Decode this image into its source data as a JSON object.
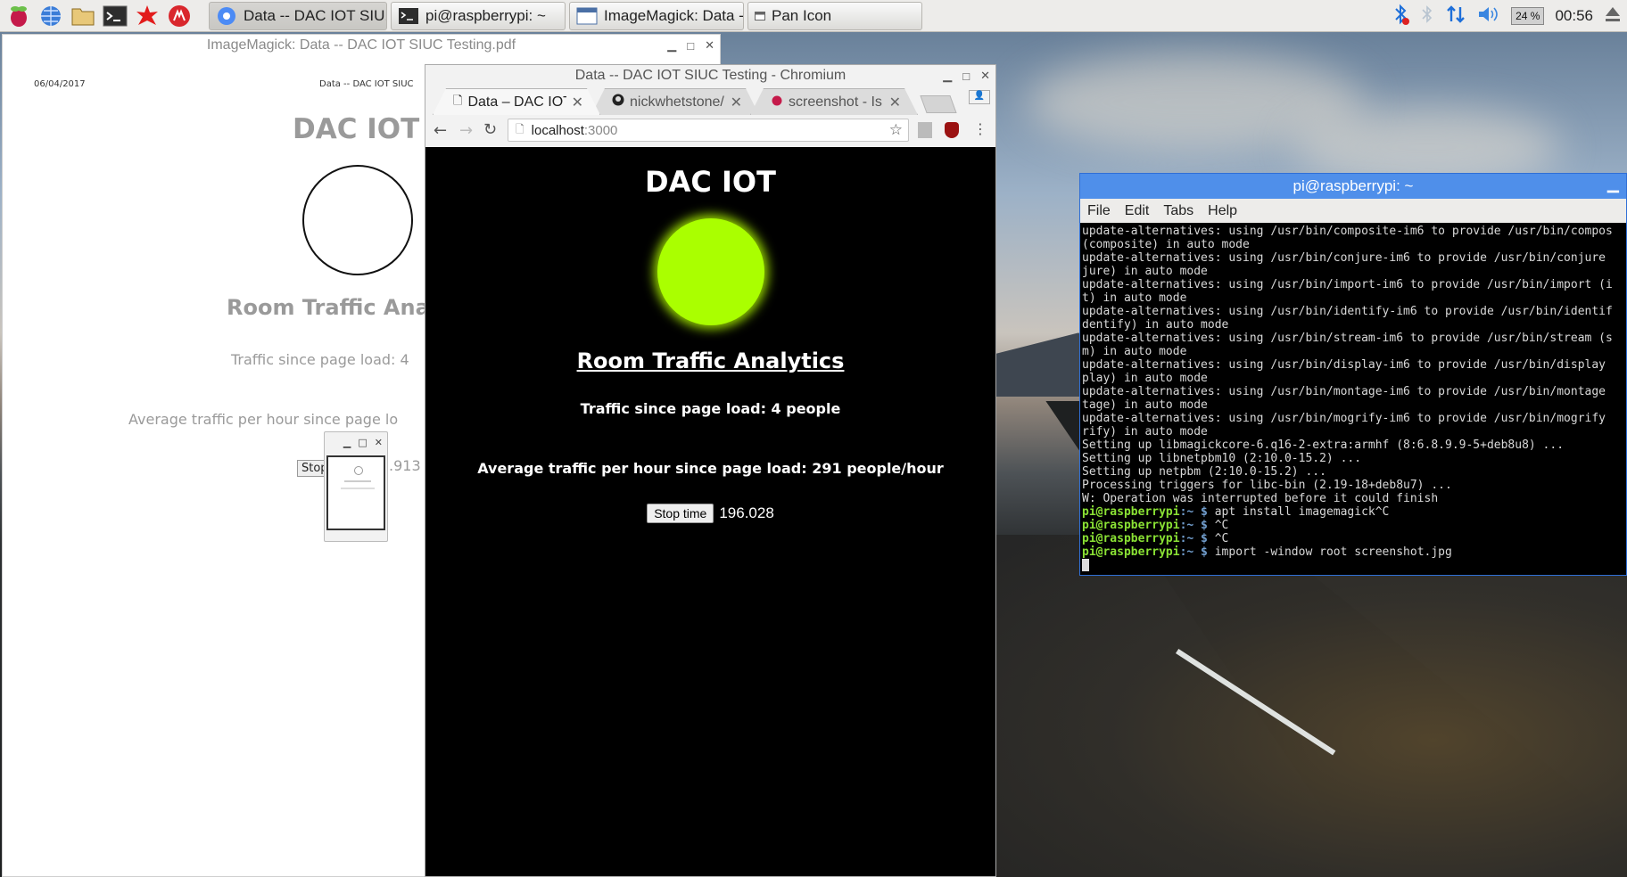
{
  "taskbar": {
    "launchers": [
      "raspberry-menu-icon",
      "web-browser-icon",
      "file-manager-icon",
      "terminal-icon",
      "math-icon",
      "wolfram-icon"
    ],
    "tasks": [
      {
        "label": "Data -- DAC IOT SIU...",
        "icon": "chromium-icon",
        "active": true
      },
      {
        "label": "pi@raspberrypi: ~",
        "icon": "terminal-icon",
        "active": false
      },
      {
        "label": "ImageMagick: Data -...",
        "icon": "window-icon",
        "active": false
      },
      {
        "label": "Pan Icon",
        "icon": "small-window-icon",
        "active": false
      }
    ],
    "tray": {
      "cpu": "24 %",
      "clock": "00:56"
    }
  },
  "imagemagick": {
    "title": "ImageMagick: Data -- DAC IOT SIUC Testing.pdf",
    "date": "06/04/2017",
    "header_right": "Data -- DAC IOT SIUC",
    "heading": "DAC IOT",
    "section": "Room Traffic Ana",
    "traffic_line": "Traffic since page load: 4",
    "avg_line": "Average traffic per hour since page lo",
    "stop_btn": "Stop",
    "timer": ".913"
  },
  "chromium": {
    "title": "Data -- DAC IOT SIUC Testing - Chromium",
    "tabs": [
      {
        "label": "Data – DAC IOT S",
        "icon": "page-icon"
      },
      {
        "label": "nickwhetstone/D",
        "icon": "github-icon"
      },
      {
        "label": "screenshot - Is th",
        "icon": "raspberry-icon"
      }
    ],
    "url_host": "localhost",
    "url_port": ":3000",
    "page": {
      "heading": "DAC IOT",
      "indicator_color": "#aaff00",
      "section": "Room Traffic Analytics",
      "traffic_line": "Traffic since page load: 4 people",
      "avg_line": "Average traffic per hour since page load: 291 people/hour",
      "stop_btn": "Stop time",
      "timer": "196.028"
    }
  },
  "terminal": {
    "title": "pi@raspberrypi: ~",
    "menu": [
      "File",
      "Edit",
      "Tabs",
      "Help"
    ],
    "lines": [
      "update-alternatives: using /usr/bin/composite-im6 to provide /usr/bin/compos",
      "(composite) in auto mode",
      "update-alternatives: using /usr/bin/conjure-im6 to provide /usr/bin/conjure",
      "jure) in auto mode",
      "update-alternatives: using /usr/bin/import-im6 to provide /usr/bin/import (i",
      "t) in auto mode",
      "update-alternatives: using /usr/bin/identify-im6 to provide /usr/bin/identif",
      "dentify) in auto mode",
      "update-alternatives: using /usr/bin/stream-im6 to provide /usr/bin/stream (s",
      "m) in auto mode",
      "update-alternatives: using /usr/bin/display-im6 to provide /usr/bin/display",
      "play) in auto mode",
      "update-alternatives: using /usr/bin/montage-im6 to provide /usr/bin/montage",
      "tage) in auto mode",
      "update-alternatives: using /usr/bin/mogrify-im6 to provide /usr/bin/mogrify",
      "rify) in auto mode",
      "Setting up libmagickcore-6.q16-2-extra:armhf (8:6.8.9.9-5+deb8u8) ...",
      "Setting up libnetpbm10 (2:10.0-15.2) ...",
      "Setting up netpbm (2:10.0-15.2) ...",
      "Processing triggers for libc-bin (2.19-18+deb8u7) ...",
      "W: Operation was interrupted before it could finish"
    ],
    "prompt_user": "pi@raspberrypi",
    "prompt_path": ":~ $",
    "commands": [
      "apt install imagemagick^C",
      "^C",
      "^C",
      "import -window root screenshot.jpg"
    ]
  }
}
